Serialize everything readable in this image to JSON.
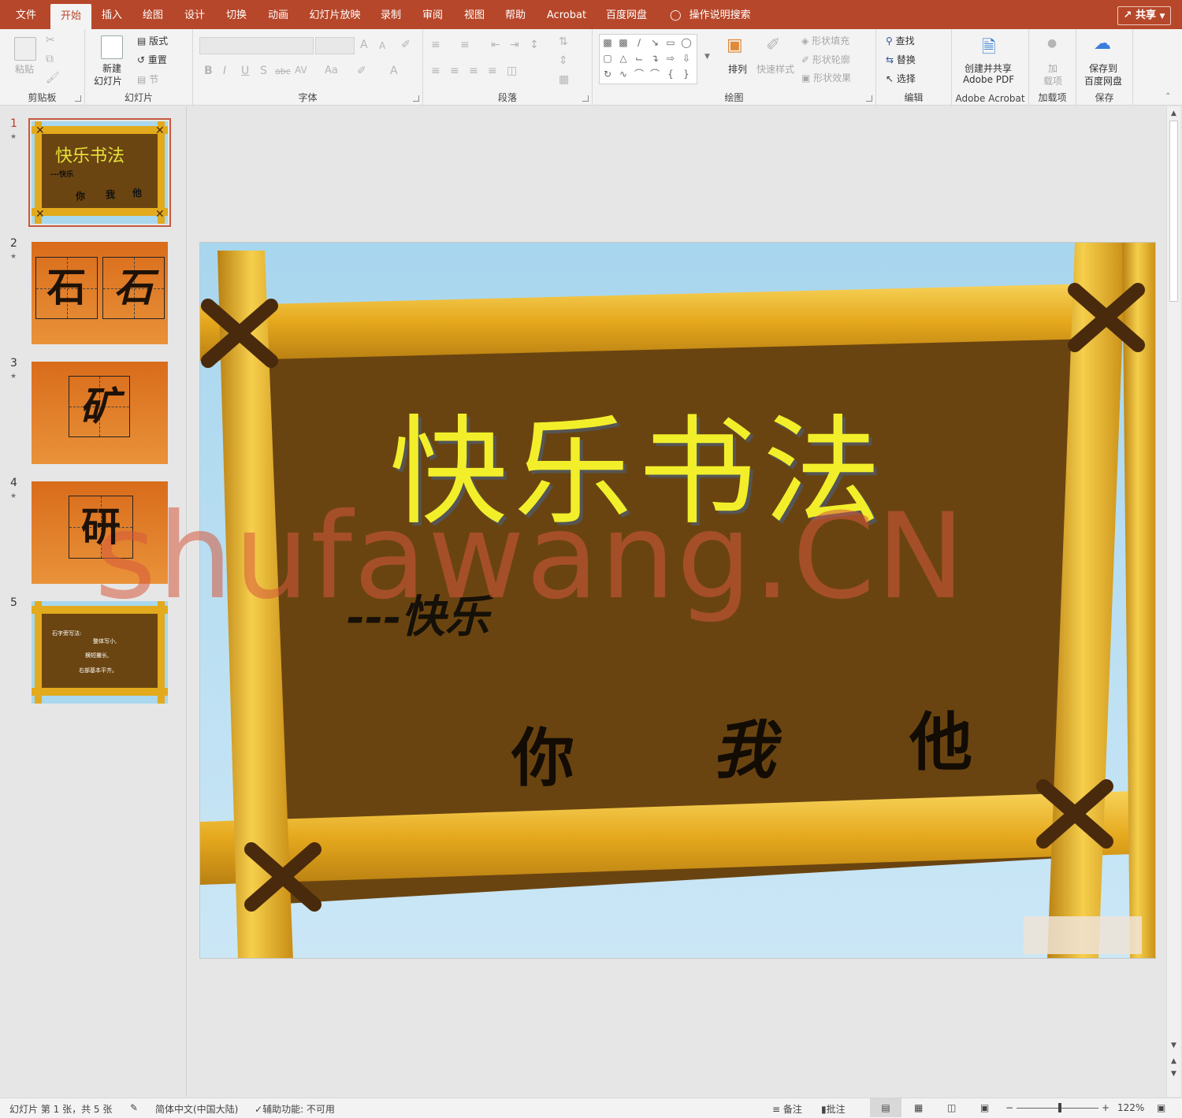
{
  "tabs": [
    "文件",
    "开始",
    "插入",
    "绘图",
    "设计",
    "切换",
    "动画",
    "幻灯片放映",
    "录制",
    "审阅",
    "视图",
    "帮助",
    "Acrobat",
    "百度网盘"
  ],
  "active_tab": "开始",
  "search": "操作说明搜索",
  "share": "共享",
  "ribbon": {
    "clipboard": {
      "paste": "粘贴",
      "label": "剪贴板"
    },
    "slides": {
      "new_slide_1": "新建",
      "new_slide_2": "幻灯片",
      "layout": "版式",
      "reset": "重置",
      "section": "节",
      "label": "幻灯片"
    },
    "font": {
      "label": "字体",
      "bold": "B",
      "italic": "I",
      "underline": "U",
      "shadow": "S",
      "strike": "abc",
      "spacing": "AV",
      "case": "Aa",
      "grow": "A",
      "shrink": "A"
    },
    "paragraph": {
      "label": "段落"
    },
    "drawing": {
      "arrange": "排列",
      "quick_styles": "快速样式",
      "fill": "形状填充",
      "outline": "形状轮廓",
      "effects": "形状效果",
      "label": "绘图"
    },
    "editing": {
      "find": "查找",
      "replace": "替换",
      "select": "选择",
      "label": "编辑"
    },
    "acrobat": {
      "line1": "创建并共享",
      "line2": "Adobe PDF",
      "label": "Adobe Acrobat"
    },
    "addins": {
      "line1": "加",
      "line2": "载项",
      "label": "加载项"
    },
    "save": {
      "line1": "保存到",
      "line2": "百度网盘",
      "label": "保存"
    }
  },
  "thumbnails": [
    {
      "num": "1",
      "title": "快乐书法",
      "sub": "---快乐",
      "chars": [
        "你",
        "我",
        "他"
      ]
    },
    {
      "num": "2",
      "chars": [
        "石",
        "石"
      ]
    },
    {
      "num": "3",
      "chars": [
        "矿"
      ]
    },
    {
      "num": "4",
      "chars": [
        "研"
      ]
    },
    {
      "num": "5",
      "lines": [
        "石字旁写法:",
        "整体写小,",
        "横短撇长,",
        "右部基本平齐。"
      ]
    }
  ],
  "slide": {
    "title": "快乐书法",
    "subtitle": "---快乐",
    "words": [
      "你",
      "我",
      "他"
    ]
  },
  "watermark": "shufawang.CN",
  "status": {
    "slide_info": "幻灯片 第 1 张，共 5 张",
    "language": "简体中文(中国大陆)",
    "accessibility": "辅助功能: 不可用",
    "notes": "备注",
    "comments": "批注",
    "zoom": "122%"
  }
}
